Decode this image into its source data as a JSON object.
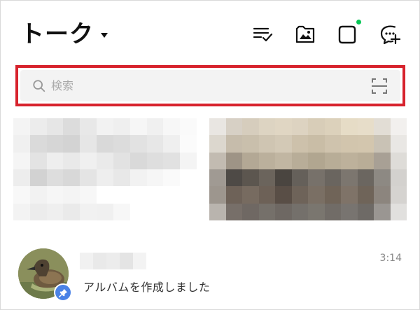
{
  "header": {
    "title": "トーク",
    "icons": [
      "edit-list-icon",
      "album-icon",
      "voom-icon",
      "new-chat-icon"
    ],
    "notification_dot_color": "#06c755"
  },
  "search": {
    "placeholder": "検索",
    "highlight_color": "#d7232d"
  },
  "chats": [
    {
      "preview": "アルバムを作成しました",
      "time": "3:14",
      "pinned": true,
      "pin_color": "#4a82e6"
    }
  ]
}
